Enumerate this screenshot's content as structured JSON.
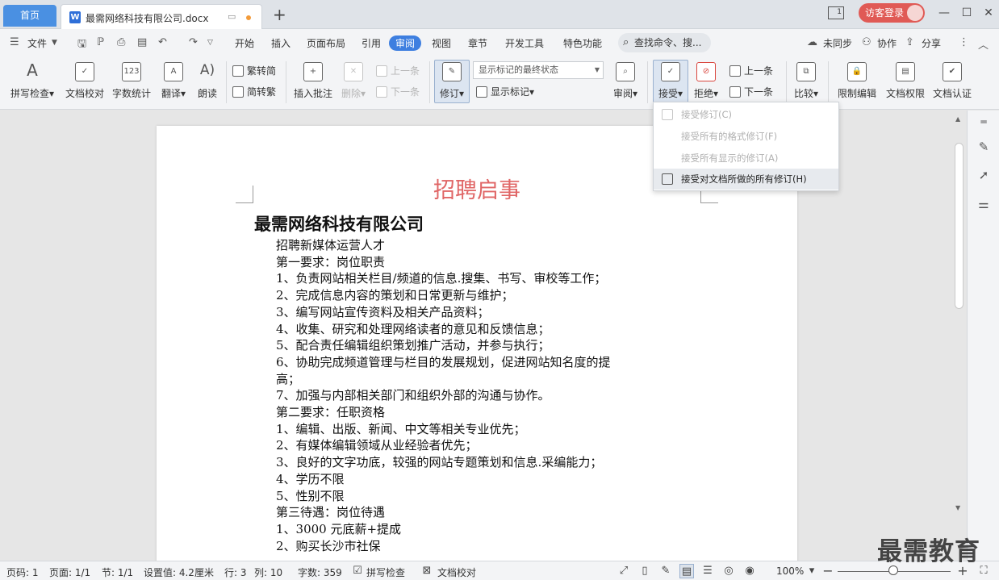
{
  "titlebar": {
    "home_tab": "首页",
    "doc_tab": "最需网络科技有限公司.docx",
    "new_tab": "+",
    "layout_badge": "1",
    "login": "访客登录",
    "minimize": "—",
    "restore": "❐",
    "maximize": "☐",
    "close": "✕"
  },
  "menubar": {
    "file": "文件",
    "tabs": [
      "开始",
      "插入",
      "页面布局",
      "引用",
      "审阅",
      "视图",
      "章节",
      "开发工具",
      "特色功能"
    ],
    "active_tab": "审阅",
    "search": "查找命令、搜...",
    "sync": "未同步",
    "collab": "协作",
    "share": "分享"
  },
  "ribbon": {
    "spell_check": "拼写检查",
    "doc_proof": "文档校对",
    "word_count": "字数统计",
    "translate": "翻译",
    "read_aloud": "朗读",
    "trad_to_simp": "繁转简",
    "simp_to_trad": "简转繁",
    "insert_comment": "插入批注",
    "delete": "删除",
    "prev_comment": "上一条",
    "next_comment": "下一条",
    "track_changes": "修订",
    "markup_select": "显示标记的最终状态",
    "show_markup": "显示标记",
    "review": "审阅",
    "accept": "接受",
    "reject": "拒绝",
    "prev_change": "上一条",
    "next_change": "下一条",
    "compare": "比较",
    "restrict_edit": "限制编辑",
    "doc_permission": "文档权限",
    "doc_cert": "文档认证"
  },
  "dropdown": {
    "items": [
      {
        "label": "接受修订(C)",
        "enabled": false
      },
      {
        "label": "接受所有的格式修订(F)",
        "enabled": false
      },
      {
        "label": "接受所有显示的修订(A)",
        "enabled": false
      },
      {
        "label": "接受对文档所做的所有修订(H)",
        "enabled": true
      }
    ]
  },
  "document": {
    "title": "招聘启事",
    "company": "最需网络科技有限公司",
    "lines": [
      "招聘新媒体运营人才",
      "第一要求：岗位职责",
      "1、负责网站相关栏目/频道的信息.搜集、书写、审校等工作；",
      "2、完成信息内容的策划和日常更新与维护；",
      "3、编写网站宣传资料及相关产品资料；",
      "4、收集、研究和处理网络读者的意见和反馈信息；",
      "5、配合责任编辑组织策划推广活动，并参与执行；",
      "6、协助完成频道管理与栏目的发展规划，促进网站知名度的提",
      "高；",
      "7、加强与内部相关部门和组织外部的沟通与协作。",
      "第二要求：任职资格",
      "1、编辑、出版、新闻、中文等相关专业优先；",
      "2、有媒体编辑领域从业经验者优先；",
      "3、良好的文字功底，较强的网站专题策划和信息.采编能力；",
      "4、学历不限",
      "5、性别不限",
      "第三待遇：岗位待遇",
      "1、3000 元底薪+提成",
      "2、购买长沙市社保"
    ]
  },
  "statusbar": {
    "page_no": "页码: 1",
    "pages": "页面: 1/1",
    "section": "节: 1/1",
    "setting": "设置值: 4.2厘米",
    "row": "行: 3",
    "col": "列: 10",
    "word_count": "字数: 359",
    "spell_check": "拼写检查",
    "doc_proof": "文档校对",
    "zoom": "100%",
    "zoom_minus": "−",
    "zoom_plus": "+"
  },
  "watermark": "最需教育",
  "colors": {
    "accent": "#3e7fe0",
    "title_red": "#e06666",
    "login_red": "#e05a55"
  }
}
